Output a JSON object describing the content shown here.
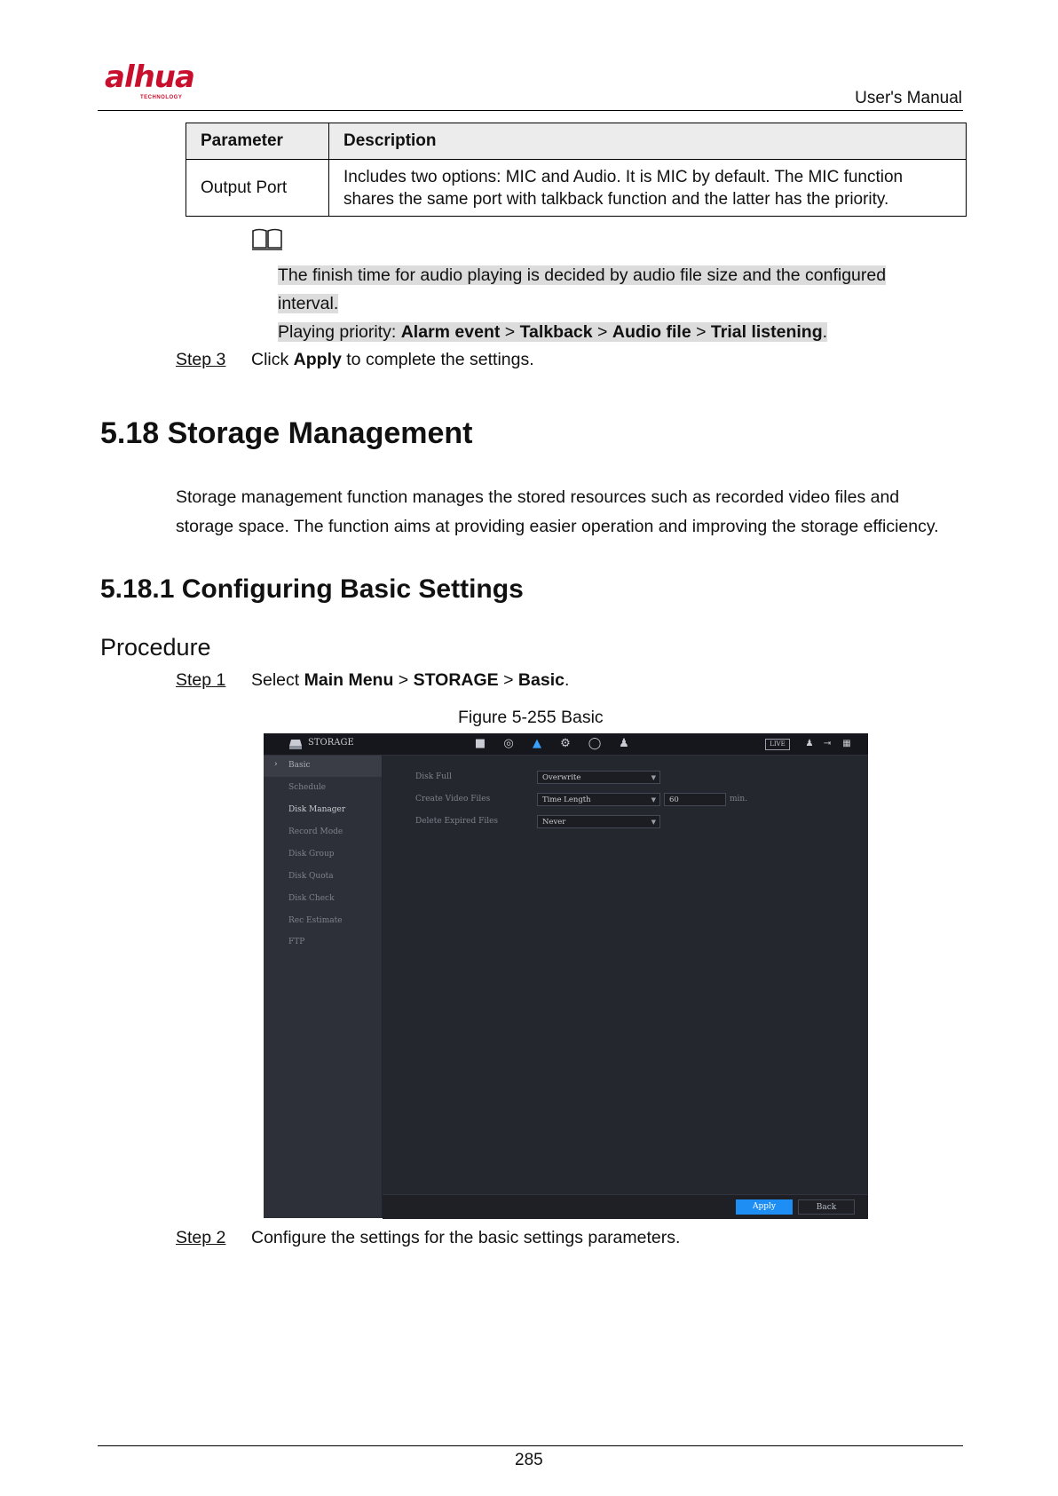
{
  "header": {
    "logo": "alhua",
    "logo_sub": "TECHNOLOGY",
    "manual": "User's Manual"
  },
  "param_table": {
    "headers": [
      "Parameter",
      "Description"
    ],
    "rows": [
      {
        "param": "Output Port",
        "desc_lines": [
          "Includes two options: MIC and Audio. It is MIC by default. The MIC function",
          "shares the same port with talkback function and the latter has the priority."
        ]
      }
    ]
  },
  "note": {
    "icon": "book-icon",
    "line1": "The finish time for audio playing is decided by audio file size and the configured",
    "line2": "interval.",
    "line3_prefix": "Playing priority: ",
    "p1": "Alarm event",
    "p2": "Talkback",
    "p3": "Audio file",
    "p4": "Trial listening",
    "sep": " > ",
    "end": "."
  },
  "step3": {
    "label": "Step 3",
    "pre": "Click ",
    "bold": "Apply",
    "post": " to complete the settings."
  },
  "section": {
    "title": "5.18 Storage Management",
    "para_line1": "Storage management function manages the stored resources such as recorded video files and",
    "para_line2": "storage space. The function aims at providing easier operation and improving the storage efficiency.",
    "sub_title": "5.18.1 Configuring Basic Settings",
    "procedure": "Procedure"
  },
  "step1": {
    "label": "Step 1",
    "pre": "Select ",
    "b1": "Main Menu",
    "b2": "STORAGE",
    "b3": "Basic",
    "sep": " > ",
    "end": "."
  },
  "figure_caption": "Figure 5-255 Basic",
  "ui": {
    "title": "STORAGE",
    "live": "LIVE",
    "top_icons": [
      "camera-icon",
      "network-icon",
      "storage-icon",
      "settings-icon",
      "shield-icon",
      "account-icon"
    ],
    "sidebar": [
      "Basic",
      "Schedule",
      "Disk Manager",
      "Record Mode",
      "Disk Group",
      "Disk Quota",
      "Disk Check",
      "Rec Estimate",
      "FTP"
    ],
    "fields": {
      "disk_full_label": "Disk Full",
      "disk_full_value": "Overwrite",
      "create_label": "Create Video Files",
      "create_value": "Time Length",
      "create_num": "60",
      "create_unit": "min.",
      "delete_label": "Delete Expired Files",
      "delete_value": "Never"
    },
    "apply": "Apply",
    "back": "Back",
    "accent": "#1e8ef5"
  },
  "step2": {
    "label": "Step 2",
    "text": "Configure the settings for the basic settings parameters."
  },
  "page_number": "285"
}
